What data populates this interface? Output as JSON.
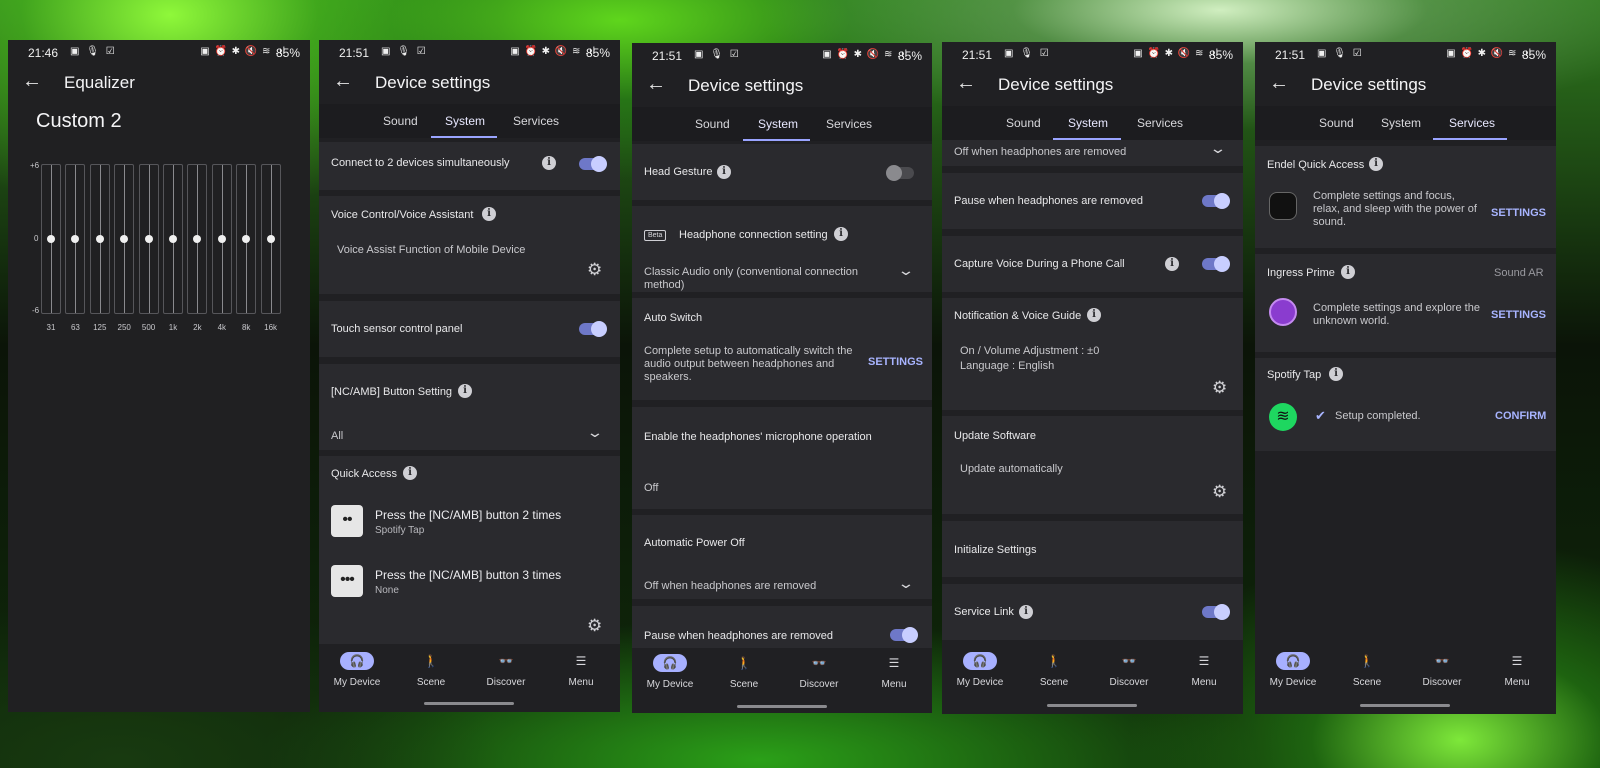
{
  "status": {
    "time_1": "21:46",
    "time_2": "21:51",
    "battery": "85%",
    "icons_left": "▣ 🎙 ☑",
    "icons_right": "▣ ⏰ ✱ 🔇 ≋ .ıl"
  },
  "equalizer": {
    "title": "Equalizer",
    "preset": "Custom 2",
    "scale_top": "+6",
    "scale_mid": "0",
    "scale_bottom": "-6",
    "bands": [
      "31",
      "63",
      "125",
      "250",
      "500",
      "1k",
      "2k",
      "4k",
      "8k",
      "16k"
    ],
    "levels_db": [
      0,
      0,
      0,
      0,
      0,
      0,
      0,
      0,
      0,
      0
    ]
  },
  "device_title": "Device settings",
  "tabs": {
    "sound": "Sound",
    "system": "System",
    "services": "Services"
  },
  "nav": {
    "my_device": "My Device",
    "scene": "Scene",
    "discover": "Discover",
    "menu": "Menu"
  },
  "screen2": {
    "connect_two": "Connect to 2 devices simultaneously",
    "voice_title": "Voice Control/Voice Assistant",
    "voice_value": "Voice Assist Function of Mobile Device",
    "touch_panel": "Touch sensor control panel",
    "nc_button": "[NC/AMB] Button Setting",
    "nc_value": "All",
    "quick_access": "Quick Access",
    "qa1_title": "Press the [NC/AMB] button 2 times",
    "qa1_sub": "Spotify Tap",
    "qa2_title": "Press the [NC/AMB] button 3 times",
    "qa2_sub": "None"
  },
  "screen3": {
    "head_gesture": "Head Gesture",
    "beta": "Beta",
    "conn_title": "Headphone connection setting",
    "conn_value": "Classic Audio only (conventional connection method)",
    "auto_switch": "Auto Switch",
    "auto_switch_desc": "Complete setup to automatically switch the audio output between headphones and speakers.",
    "settings": "SETTINGS",
    "mic_title": "Enable the headphones' microphone operation",
    "mic_value": "Off",
    "power_off": "Automatic Power Off",
    "power_value": "Off when headphones are removed",
    "pause": "Pause when headphones are removed"
  },
  "screen4": {
    "top_value": "Off when headphones are removed",
    "pause": "Pause when headphones are removed",
    "capture": "Capture Voice During a Phone Call",
    "notif": "Notification & Voice Guide",
    "notif_v1": "On / Volume Adjustment : ±0",
    "notif_v2": "Language : English",
    "update": "Update Software",
    "update_value": "Update automatically",
    "init": "Initialize Settings",
    "service_link": "Service Link"
  },
  "screen5": {
    "endel": "Endel Quick Access",
    "endel_desc": "Complete settings and focus, relax, and sleep with the power of sound.",
    "settings": "SETTINGS",
    "ingress": "Ingress Prime",
    "sound_ar": "Sound AR",
    "ingress_desc": "Complete settings and explore the unknown world.",
    "spotify": "Spotify Tap",
    "spotify_status": "Setup completed.",
    "confirm": "CONFIRM"
  },
  "colors": {
    "accent": "#a7b0ff",
    "toggle_on": "#6e78c8",
    "card": "#2a2a2e",
    "background": "#202023"
  }
}
